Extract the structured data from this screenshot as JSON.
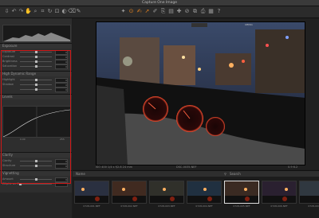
{
  "window": {
    "title": "Capture One Image",
    "traffic_lights": [
      "#e0443c",
      "#e0a030",
      "#3caa3c"
    ]
  },
  "toolbar": {
    "icons": [
      "import-icon",
      "undo-icon",
      "redo-icon",
      "hand-icon",
      "zoom-icon",
      "crop-icon",
      "rotate-icon",
      "keystone-icon",
      "mask-icon",
      "eraser-icon",
      "picker-icon",
      "spot-icon",
      "white-balance-icon",
      "annotate-icon",
      "cursor-icon",
      "brush-icon",
      "stamp-icon",
      "gradient-icon",
      "heal-icon",
      "pipette-icon",
      "copy-icon",
      "paste-icon",
      "grid-icon",
      "help-icon"
    ],
    "accent": "#e08020"
  },
  "left_panel": {
    "histogram_values": [
      "0.0",
      "0.0"
    ],
    "sections": [
      {
        "title": "Exposure",
        "rows": [
          {
            "label": "Exposure",
            "value": "0",
            "pos": 0.5
          },
          {
            "label": "Contrast",
            "value": "0",
            "pos": 0.5
          },
          {
            "label": "Brightness",
            "value": "0",
            "pos": 0.5
          },
          {
            "label": "Saturation",
            "value": "0",
            "pos": 0.5
          }
        ]
      },
      {
        "title": "High Dynamic Range",
        "rows": [
          {
            "label": "Highlight",
            "value": "0",
            "pos": 0.5
          },
          {
            "label": "Shadow",
            "value": "0",
            "pos": 0.5
          },
          {
            "label": "",
            "value": "0",
            "pos": 0.5
          }
        ]
      },
      {
        "title": "Levels",
        "tabs": [
          "RGB",
          "Red",
          "Green",
          "Blue"
        ],
        "curve_values": [
          "0.00",
          "255"
        ]
      },
      {
        "title": "Clarity",
        "rows": [
          {
            "label": "Clarity",
            "value": "0",
            "pos": 0.5
          },
          {
            "label": "Structure",
            "value": "0",
            "pos": 0.5
          }
        ]
      },
      {
        "title": "Vignetting",
        "rows": [
          {
            "label": "Amount",
            "value": "0",
            "pos": 0.5
          },
          {
            "label": "Elliptic on Crop",
            "value": "",
            "pos": 0
          }
        ]
      }
    ]
  },
  "viewer": {
    "badge": "Off/On",
    "status": {
      "left": "ISO 400   1/4 s   f/2.8   24 mm",
      "center": "DSC-0035.NEF",
      "right": "0.9 6.2"
    }
  },
  "browser": {
    "label": "Name",
    "search": "Search",
    "thumbnails": [
      {
        "caption": "0728-001.NEF",
        "selected": false
      },
      {
        "caption": "0728-002.NEF",
        "selected": false
      },
      {
        "caption": "0728-003.NEF",
        "selected": false
      },
      {
        "caption": "0728-004.NEF",
        "selected": false
      },
      {
        "caption": "0728-005.NEF",
        "selected": true
      },
      {
        "caption": "0728-006.NEF",
        "selected": false
      },
      {
        "caption": "0728-007.NEF",
        "selected": false
      }
    ]
  }
}
